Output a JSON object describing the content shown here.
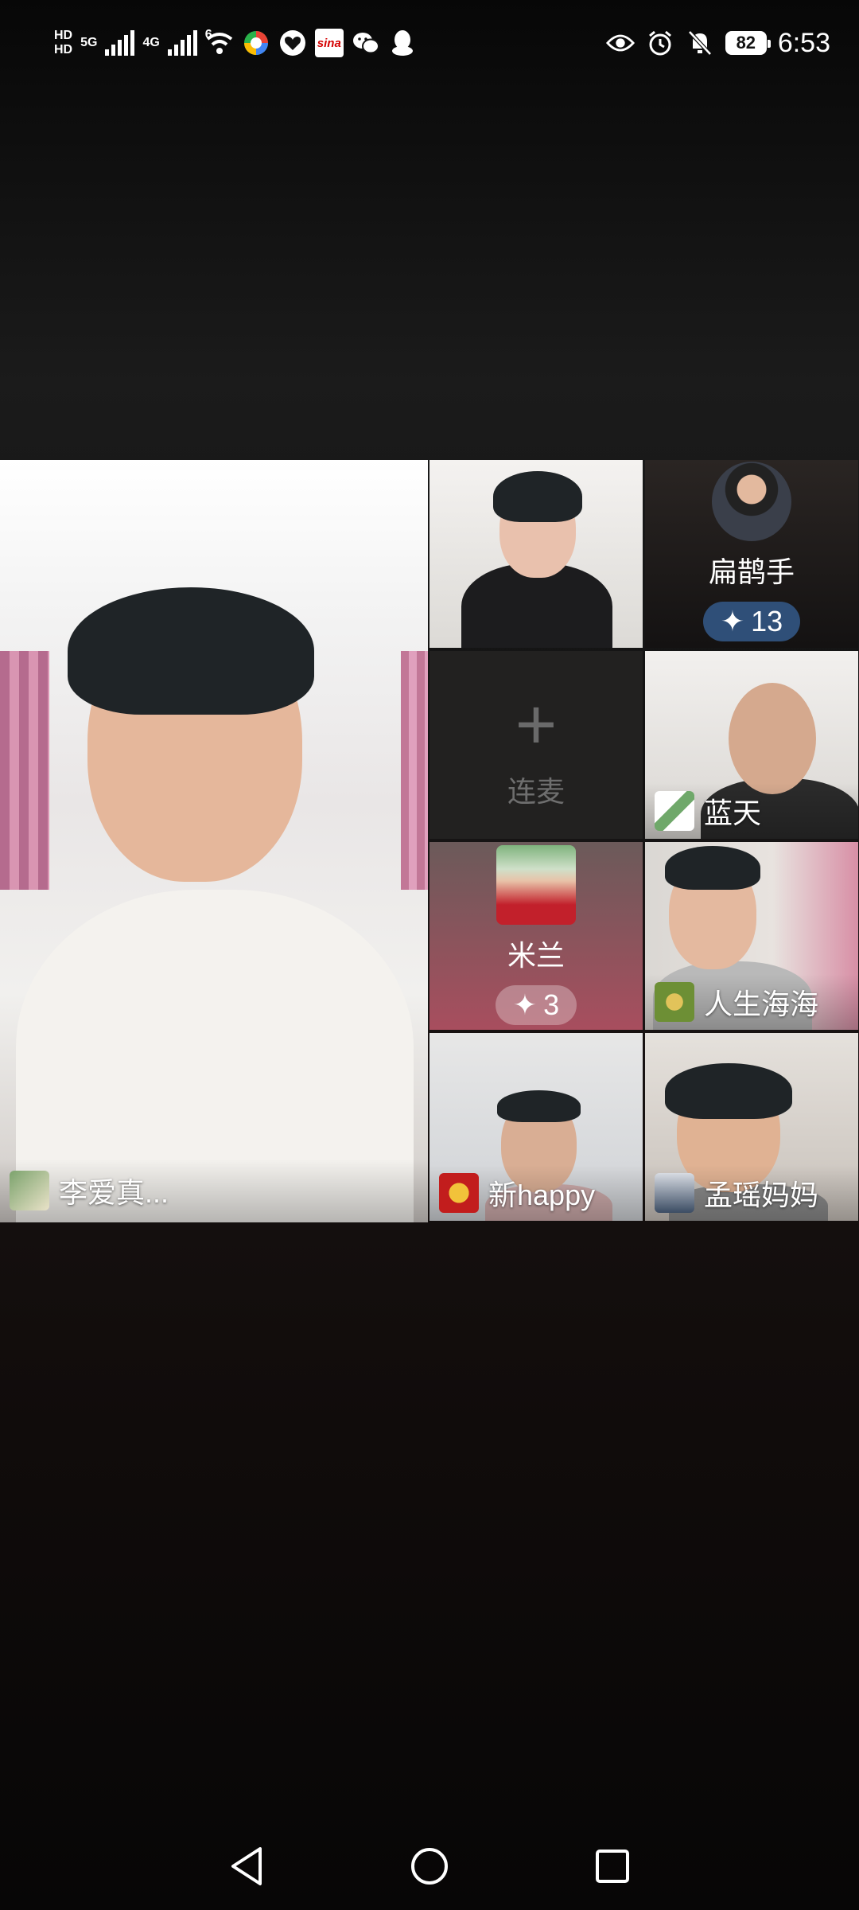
{
  "status_bar": {
    "left": {
      "hd1": "HD",
      "hd2": "HD",
      "net1": "5G",
      "net2": "4G",
      "wifi_badge": "6",
      "sina_label": "sina"
    },
    "right": {
      "battery": "82",
      "time": "6:53"
    }
  },
  "grid": {
    "main": {
      "name": "李爱真..."
    },
    "tiles": [
      {
        "name": ""
      },
      {
        "name": "扁鹊手",
        "badge": "13"
      },
      {
        "join_label": "连麦"
      },
      {
        "name": "蓝天"
      },
      {
        "name": "米兰",
        "badge": "3"
      },
      {
        "name": "人生海海"
      },
      {
        "name": "新happy"
      },
      {
        "name": "孟瑶妈妈"
      }
    ]
  },
  "colors": {
    "badge_blue": "#2f4f78"
  }
}
